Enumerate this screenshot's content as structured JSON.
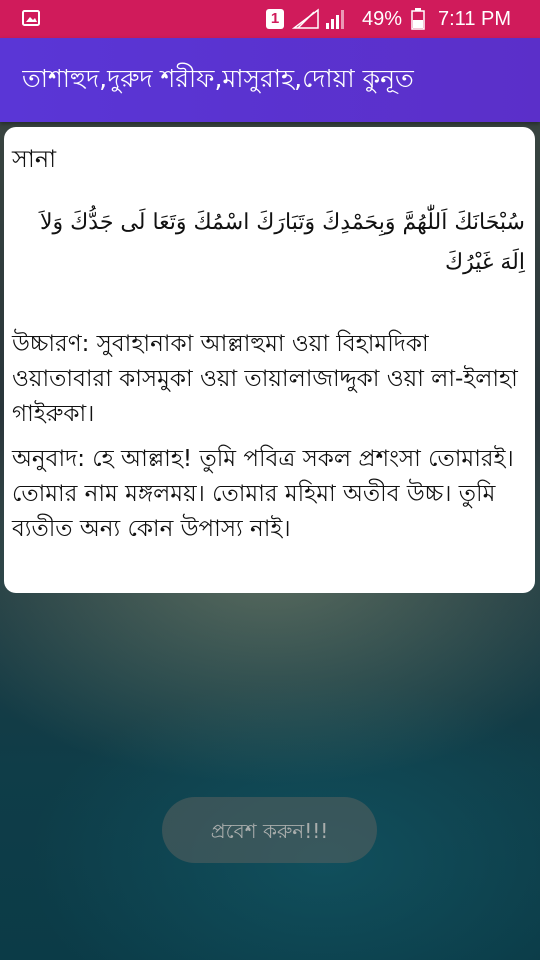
{
  "status_bar": {
    "sim_slot": "1",
    "battery": "49%",
    "time": "7:11 PM",
    "icons": [
      "image-notification-icon",
      "signal-icon",
      "signal-icon",
      "battery-icon"
    ]
  },
  "app_bar": {
    "title": "তাশাহুদ,দুরুদ শরীফ,মাসুরাহ,দোয়া কুনূত"
  },
  "card": {
    "heading": "সানা",
    "arabic": "سُبْحَانَكَ اَللّٰهُمَّ وَبِحَمْدِكَ وَتَبَارَكَ اسْمُكَ وَتَعَا لَى جَدُّكَ وَلاَ اِلَهَ غَيْرُكَ",
    "pronunciation": "উচ্চারণ: সুবাহানাকা আল্লাহুমা ওয়া বিহামদিকা ওয়াতাবারা কাসমুকা ওয়া তায়ালাজাদ্দুকা ওয়া লা-ইলাহা গাইরুকা।",
    "translation": "অনুবাদ: হে আল্লাহ! তুমি পবিত্র সকল প্রশংসা তোমারই। তোমার নাম মঙ্গলময়। তোমার মহিমা অতীব উচ্চ। তুমি ব্যতীত অন্য কোন উপাস্য নাই।"
  },
  "enter_button": {
    "label": "প্রবেশ করুন!!!"
  },
  "colors": {
    "status_bar": "#d01b5b",
    "app_bar": "#5a36d6",
    "card_bg": "#ffffff"
  }
}
